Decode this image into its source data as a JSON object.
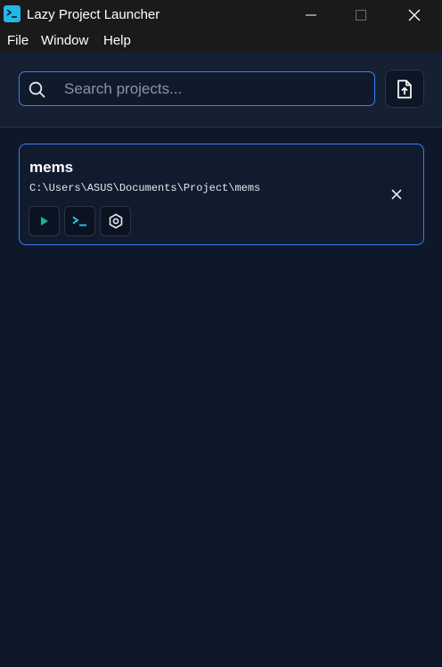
{
  "window": {
    "title": "Lazy Project Launcher",
    "icon": "terminal-icon"
  },
  "menubar": {
    "items": [
      {
        "label": "File"
      },
      {
        "label": "Window"
      },
      {
        "label": "Help"
      }
    ]
  },
  "search": {
    "placeholder": "Search projects...",
    "value": ""
  },
  "projects": [
    {
      "name": "mems",
      "path": "C:\\Users\\ASUS\\Documents\\Project\\mems",
      "actions": [
        "play-icon",
        "terminal-icon",
        "settings-icon"
      ]
    }
  ],
  "colors": {
    "accent": "#3b82f6",
    "run": "#10b981",
    "terminal": "#22d3ee",
    "background": "#0f172a"
  }
}
